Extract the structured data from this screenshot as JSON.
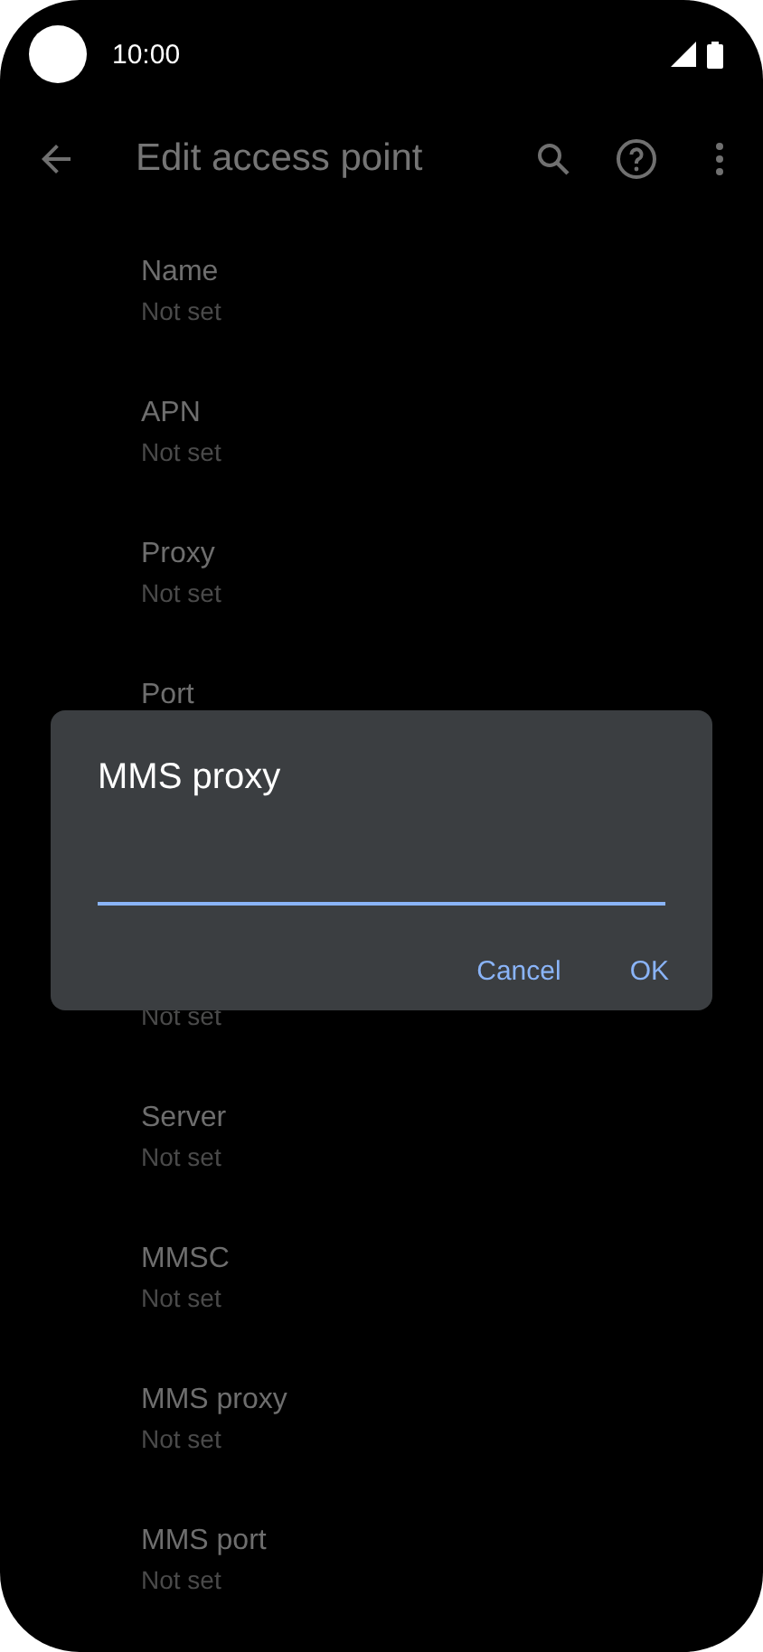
{
  "status_bar": {
    "time": "10:00"
  },
  "toolbar": {
    "title": "Edit access point"
  },
  "items": [
    {
      "label": "Name",
      "value": "Not set"
    },
    {
      "label": "APN",
      "value": "Not set"
    },
    {
      "label": "Proxy",
      "value": "Not set"
    },
    {
      "label": "Port"
    },
    {
      "value": "Not set"
    },
    {
      "label": "Server",
      "value": "Not set"
    },
    {
      "label": "MMSC",
      "value": "Not set"
    },
    {
      "label": "MMS proxy",
      "value": "Not set"
    },
    {
      "label": "MMS port",
      "value": "Not set"
    }
  ],
  "dialog": {
    "title": "MMS proxy",
    "buttons": [
      "Cancel",
      "OK"
    ]
  }
}
